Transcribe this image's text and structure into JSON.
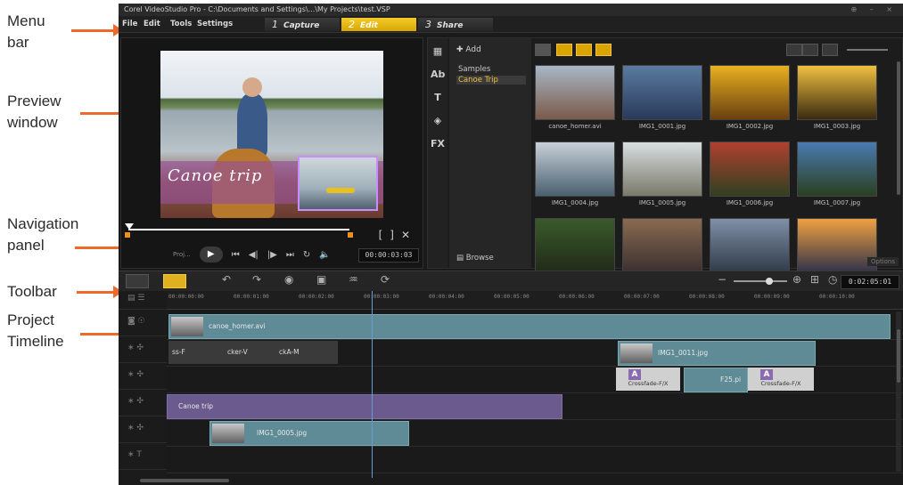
{
  "annotations": {
    "menu_bar_1": "Menu",
    "menu_bar_2": "bar",
    "preview_1": "Preview",
    "preview_2": "window",
    "nav_1": "Navigation",
    "nav_2": "panel",
    "toolbar": "Toolbar",
    "timeline_1": "Project",
    "timeline_2": "Timeline",
    "arrow_color": "#ee6a2c"
  },
  "window": {
    "title": "Corel VideoStudio Pro - C:\\Documents and Settings\\...\\My Projects\\test.VSP",
    "controls": "⊕ – ×"
  },
  "menu": {
    "file": "File",
    "edit": "Edit",
    "tools": "Tools",
    "settings": "Settings"
  },
  "steps": [
    {
      "num": "1",
      "label": "Capture",
      "active": false
    },
    {
      "num": "2",
      "label": "Edit",
      "active": true
    },
    {
      "num": "3",
      "label": "Share",
      "active": false
    }
  ],
  "preview": {
    "title_overlay": "Canoe trip",
    "timecode": "00:00:03:03",
    "project_label": "Proj...",
    "accent_color": "#c98dff"
  },
  "library": {
    "add_label": "Add",
    "folders": [
      "Samples",
      "Canoe Trip"
    ],
    "selected_folder": "Canoe Trip",
    "browse_label": "Browse",
    "options_label": "Options",
    "thumbnails": [
      {
        "name": "canoe_homer.avi",
        "colors": [
          "#a7b7c6",
          "#7a5a4a"
        ]
      },
      {
        "name": "IMG1_0001.jpg",
        "colors": [
          "#5a7aa0",
          "#2a3a5a"
        ]
      },
      {
        "name": "IMG1_0002.jpg",
        "colors": [
          "#e8b020",
          "#6a4010"
        ]
      },
      {
        "name": "IMG1_0003.jpg",
        "colors": [
          "#f0c040",
          "#3a2a10"
        ]
      },
      {
        "name": "IMG1_0004.jpg",
        "colors": [
          "#c8d0d8",
          "#4a6070"
        ]
      },
      {
        "name": "IMG1_0005.jpg",
        "colors": [
          "#d8dde0",
          "#7a7a6a"
        ]
      },
      {
        "name": "IMG1_0006.jpg",
        "colors": [
          "#b04030",
          "#304020"
        ]
      },
      {
        "name": "IMG1_0007.jpg",
        "colors": [
          "#4a7ab0",
          "#2a4020"
        ]
      },
      {
        "name": "",
        "colors": [
          "#3a5a2a",
          "#202a18"
        ]
      },
      {
        "name": "",
        "colors": [
          "#8a6a50",
          "#3a3030"
        ]
      },
      {
        "name": "",
        "colors": [
          "#8090a8",
          "#303a48"
        ]
      },
      {
        "name": "",
        "colors": [
          "#f0a040",
          "#30324a"
        ]
      }
    ]
  },
  "timeline": {
    "total_time": "0:02:05:01",
    "ruler": [
      "00:00:00:00",
      "00:00:01:00",
      "00:00:02:00",
      "00:00:03:00",
      "00:00:04:00",
      "00:00:05:00",
      "00:00:06:00",
      "00:00:07:00",
      "00:00:08:00",
      "00:00:09:00",
      "00:00:10:00"
    ],
    "video_clip": "canoe_homer.avi",
    "overlay_clips": [
      "ss-F",
      "cker-V",
      "ckA-M"
    ],
    "overlay_right_clip": "IMG1_0011.jpg",
    "fx_clips": [
      "Crossfade-F/X",
      "F25.pi",
      "Crossfade-F/X"
    ],
    "title_clip": "Canoe trip",
    "overlay2_clip": "IMG1_0005.jpg"
  }
}
